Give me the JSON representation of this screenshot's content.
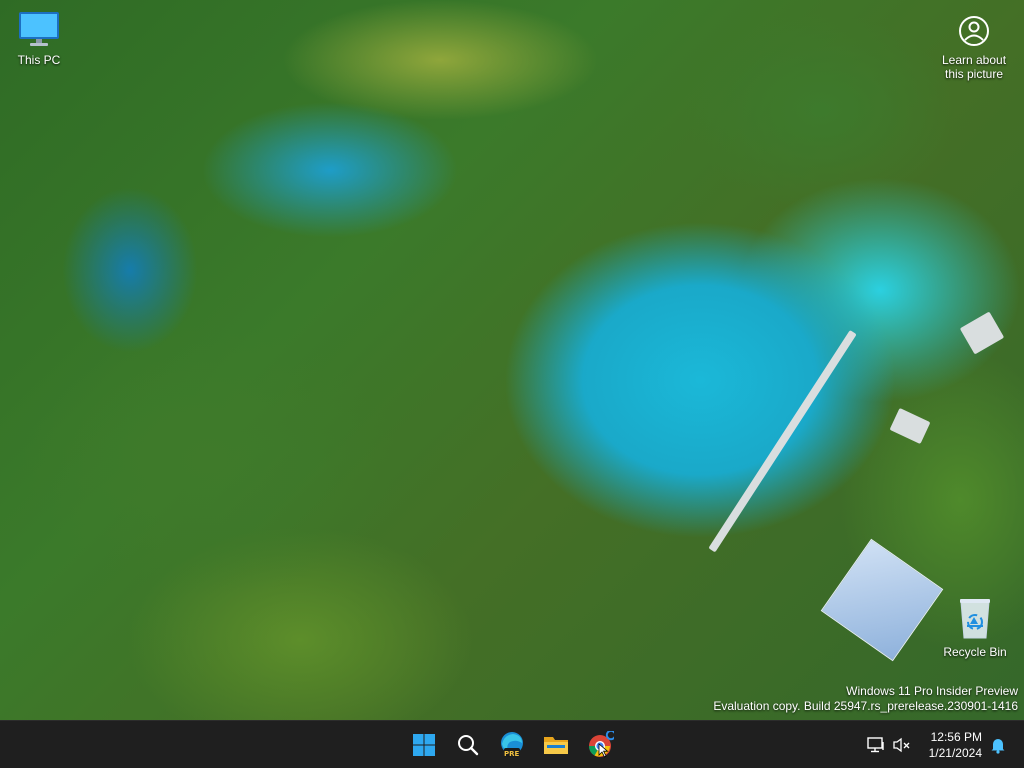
{
  "desktop": {
    "icons": [
      {
        "label": "This PC",
        "icon": "monitor-icon"
      },
      {
        "label": "Recycle Bin",
        "icon": "recycle-bin-icon"
      }
    ],
    "learn": {
      "line1": "Learn about",
      "line2": "this picture",
      "icon": "camera-info-icon"
    },
    "watermark": {
      "line1": "Windows 11 Pro Insider Preview",
      "line2": "Evaluation copy. Build 25947.rs_prerelease.230901-1416"
    }
  },
  "taskbar": {
    "buttons": [
      {
        "name": "start",
        "icon": "windows-logo-icon"
      },
      {
        "name": "search",
        "icon": "search-icon"
      },
      {
        "name": "edge-preview",
        "icon": "edge-pre-icon",
        "badge": "PRE"
      },
      {
        "name": "file-explorer",
        "icon": "folder-icon"
      },
      {
        "name": "chrome",
        "icon": "chrome-icon"
      }
    ],
    "tray": {
      "network_icon": "network-icon",
      "volume_icon": "volume-muted-icon",
      "time": "12:56 PM",
      "date": "1/21/2024",
      "notification_icon": "bell-icon"
    }
  },
  "colors": {
    "taskbar_bg": "#1f1f1f",
    "accent": "#0078d4",
    "water": "#1bb8d8",
    "foliage": "#3b7a2a"
  }
}
